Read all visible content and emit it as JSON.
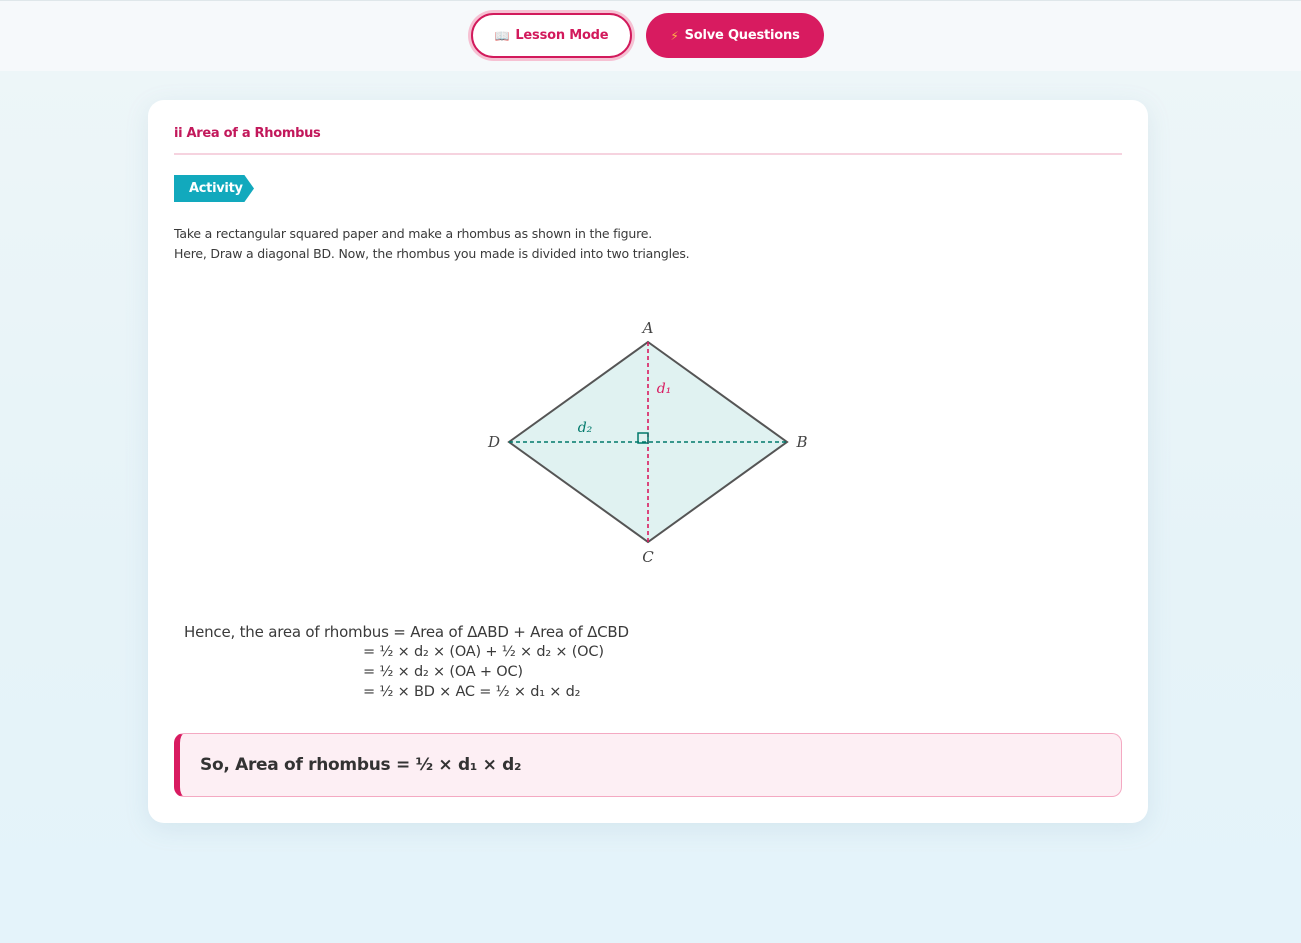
{
  "mode_toggle": {
    "lesson_icon": "📖",
    "lesson_label": "Lesson Mode",
    "solve_icon": "⚡",
    "solve_label": "Solve Questions"
  },
  "section": {
    "title": "ii Area of a Rhombus",
    "tag": "Activity",
    "intro_lines": [
      "Take a rectangular squared paper and make a rhombus as shown in the figure.",
      "Here, Draw a diagonal BD. Now, the rhombus you made is divided into two triangles."
    ]
  },
  "figure": {
    "vertex_a": "A",
    "vertex_b": "B",
    "vertex_c": "C",
    "vertex_d": "D",
    "label_d1": "d₁",
    "label_d2": "d₂",
    "fill_color": "#e0f2f1",
    "d1_color": "#d81b60",
    "d2_color": "#00796b"
  },
  "derivation": {
    "line1": "Hence, the area of rhombus = Area of ΔABD + Area of ΔCBD",
    "line2": "= ½ × d₂ × (OA) + ½ × d₂ × (OC)",
    "line3": "= ½ × d₂ × (OA + OC)",
    "line4": "= ½ × BD × AC = ½ × d₁ × d₂"
  },
  "result": {
    "text": "So, Area of rhombus = ½ × d₁ × d₂"
  },
  "colors": {
    "accent": "#d81b60",
    "tag": "#12a9bd"
  }
}
